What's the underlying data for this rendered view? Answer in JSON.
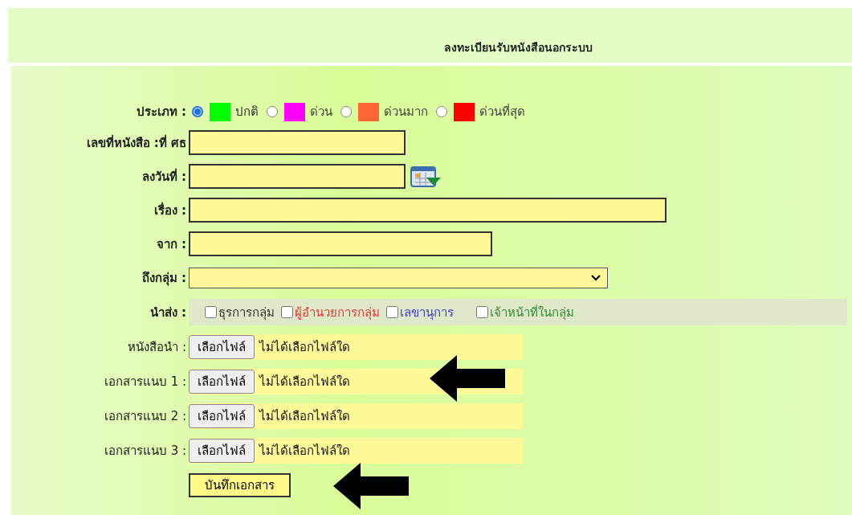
{
  "title": "ลงทะเบียนรับหนังสือนอกระบบ",
  "type_field": {
    "label": "ประเภท :",
    "options": [
      {
        "label": "ปกติ",
        "color": "#00ff00",
        "selected": true
      },
      {
        "label": "ด่วน",
        "color": "#ff00ff",
        "selected": false
      },
      {
        "label": "ด่วนมาก",
        "color": "#ff6633",
        "selected": false
      },
      {
        "label": "ด่วนที่สุด",
        "color": "#ff0000",
        "selected": false
      }
    ]
  },
  "fields": [
    {
      "kind": "text",
      "label": "เลขที่หนังสือ :ที่ ศธ"
    },
    {
      "kind": "date",
      "label": "ลงวันที่ :"
    },
    {
      "kind": "text",
      "label": "เรื่อง :"
    },
    {
      "kind": "text",
      "label": "จาก :"
    },
    {
      "kind": "select",
      "label": "ถึงกลุ่ม :"
    }
  ],
  "send_to": {
    "label": "นำส่ง :",
    "options": [
      {
        "label": "ธุรการกลุ่ม",
        "checked": false,
        "color": "#333333"
      },
      {
        "label": "ผู้อำนวยการกลุ่ม",
        "checked": false,
        "color": "#e53935"
      },
      {
        "label": "เลขานุการ",
        "checked": false,
        "color": "#3b3bd9"
      },
      {
        "label": "เจ้าหน้าที่ในกลุ่ม",
        "checked": false,
        "color": "#3a8a3a"
      }
    ]
  },
  "attachments": [
    {
      "label": "หนังสือนำ :",
      "button": "เลือกไฟล์",
      "status": "ไม่ได้เลือกไฟล์ใด"
    },
    {
      "label": "เอกสารแนบ 1 :",
      "button": "เลือกไฟล์",
      "status": "ไม่ได้เลือกไฟล์ใด"
    },
    {
      "label": "เอกสารแนบ 2 :",
      "button": "เลือกไฟล์",
      "status": "ไม่ได้เลือกไฟล์ใด"
    },
    {
      "label": "เอกสารแนบ 3 :",
      "button": "เลือกไฟล์",
      "status": "ไม่ได้เลือกไฟล์ใด"
    }
  ],
  "save_button": "บันทึกเอกสาร"
}
